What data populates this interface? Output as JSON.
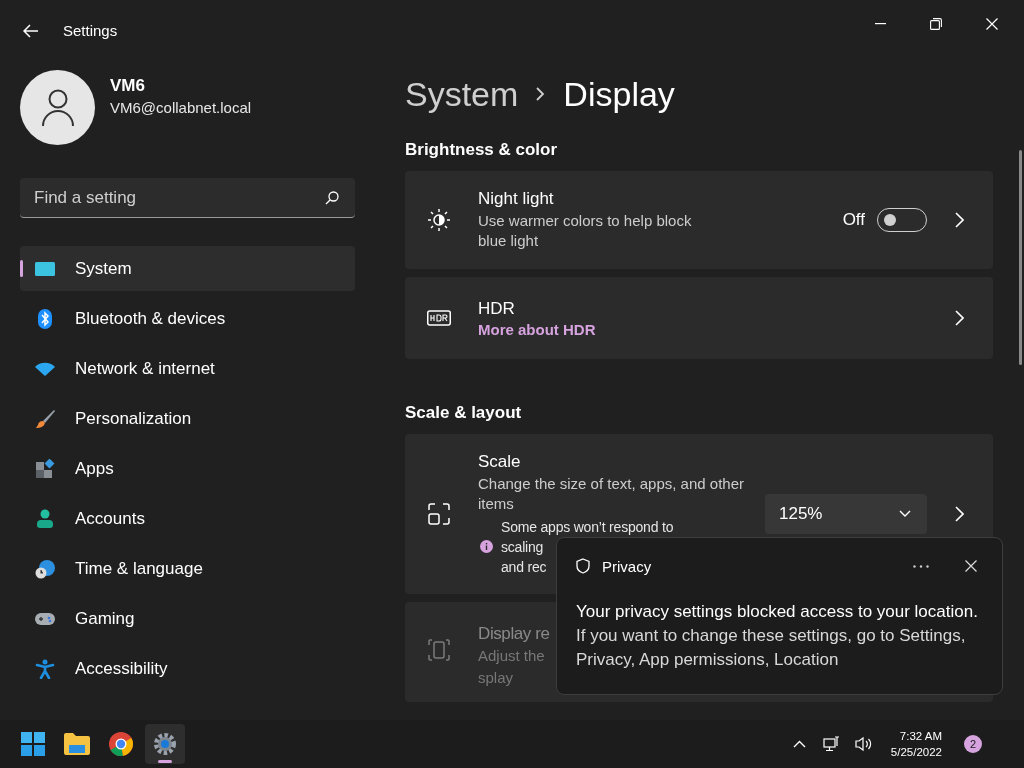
{
  "window": {
    "title": "Settings"
  },
  "user": {
    "name": "VM6",
    "email": "VM6@collabnet.local"
  },
  "search": {
    "placeholder": "Find a setting"
  },
  "nav": [
    {
      "label": "System",
      "selected": true
    },
    {
      "label": "Bluetooth & devices",
      "selected": false
    },
    {
      "label": "Network & internet",
      "selected": false
    },
    {
      "label": "Personalization",
      "selected": false
    },
    {
      "label": "Apps",
      "selected": false
    },
    {
      "label": "Accounts",
      "selected": false
    },
    {
      "label": "Time & language",
      "selected": false
    },
    {
      "label": "Gaming",
      "selected": false
    },
    {
      "label": "Accessibility",
      "selected": false
    }
  ],
  "breadcrumb": [
    "System",
    "Display"
  ],
  "sections": [
    {
      "title": "Brightness & color",
      "cards": [
        {
          "kind": "toggle",
          "title": "Night light",
          "description": "Use warmer colors to help block blue light",
          "state_label": "Off",
          "on": false
        },
        {
          "kind": "link",
          "title": "HDR",
          "link": "More about HDR"
        }
      ]
    },
    {
      "title": "Scale & layout",
      "cards": [
        {
          "kind": "dropdown",
          "title": "Scale",
          "description": "Change the size of text, apps, and other items",
          "value": "125%",
          "note_lines": [
            "Some apps won’t respond to",
            "scaling",
            "and rec"
          ]
        },
        {
          "kind": "plain",
          "title": "Display re",
          "description_lines": [
            "Adjust the",
            "splay"
          ],
          "disabled": true
        }
      ]
    }
  ],
  "toast": {
    "title": "Privacy",
    "headline": "Your privacy settings blocked access to your location.",
    "body": "If you want to change these settings, go to Settings, Privacy, App permissions, Location"
  },
  "taskbar": {
    "apps": [
      {
        "selected": false
      },
      {
        "selected": false
      },
      {
        "selected": false
      },
      {
        "selected": true
      }
    ],
    "time": "7:32 AM",
    "date": "5/25/2022",
    "notifications": "2"
  }
}
